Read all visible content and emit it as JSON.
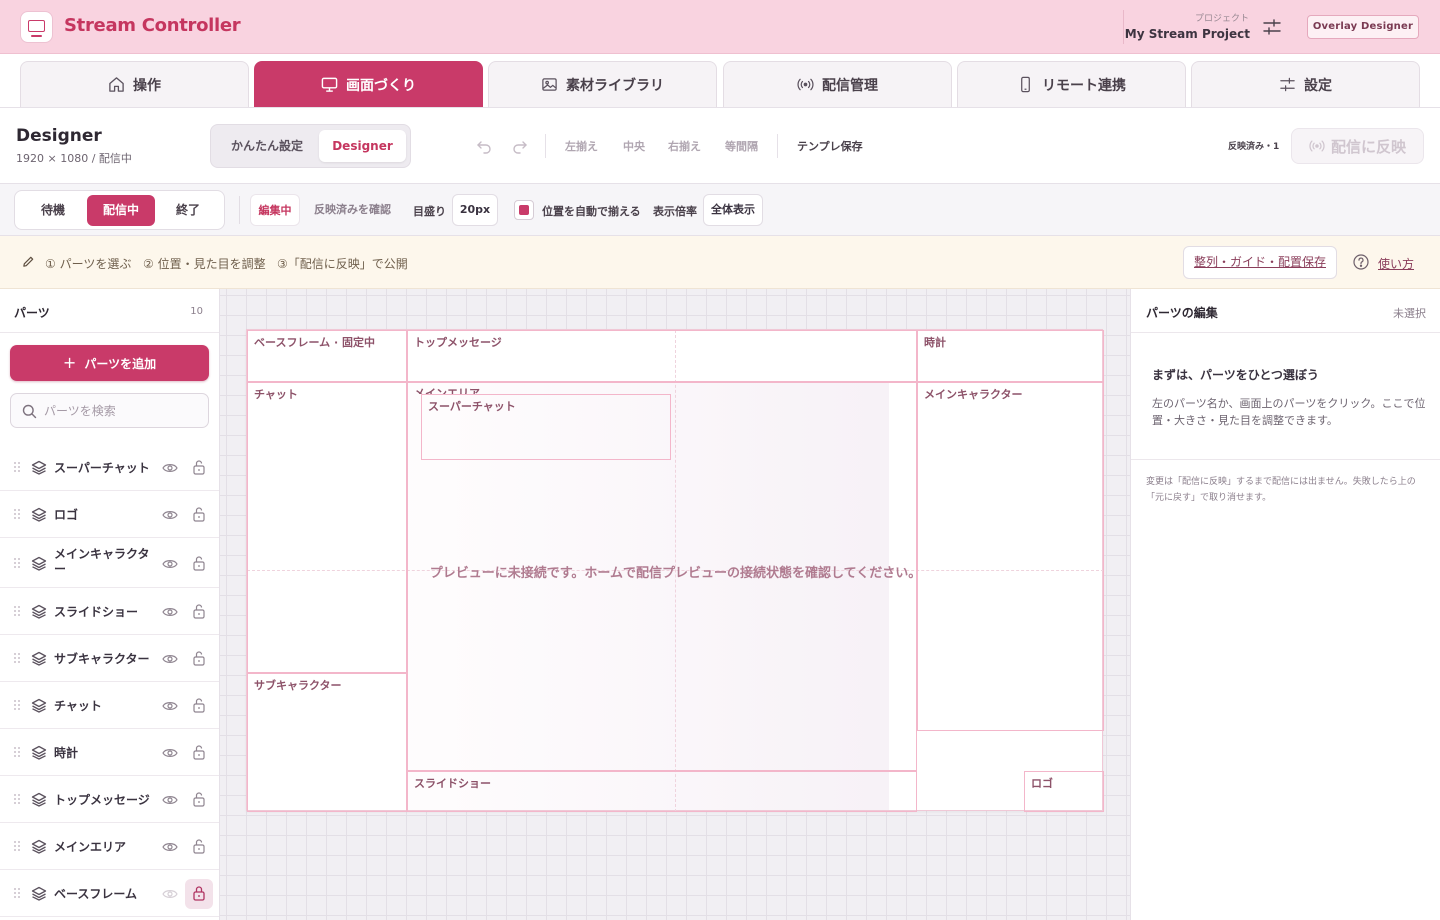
{
  "header": {
    "app_title": "Stream Controller",
    "project_caption": "プロジェクト",
    "project_name": "My Stream Project",
    "overlay_button": "Overlay Designer"
  },
  "tabs": [
    {
      "label": "操作",
      "icon": "home-icon"
    },
    {
      "label": "画面づくり",
      "icon": "monitor-icon",
      "active": true
    },
    {
      "label": "素材ライブラリ",
      "icon": "image-icon"
    },
    {
      "label": "配信管理",
      "icon": "broadcast-icon"
    },
    {
      "label": "リモート連携",
      "icon": "phone-icon"
    },
    {
      "label": "設定",
      "icon": "sliders-icon"
    }
  ],
  "toolbar": {
    "title": "Designer",
    "subtitle": "1920 × 1080 / 配信中",
    "mode_easy": "かんたん設定",
    "mode_designer": "Designer",
    "align_left": "左揃え",
    "align_center": "中央",
    "align_right": "右揃え",
    "distribute": "等間隔",
    "save_template": "テンプレ保存",
    "reflect_count": "反映済み・1",
    "reflect_button": "配信に反映"
  },
  "scene_bar": {
    "scenes": [
      "待機",
      "配信中",
      "終了"
    ],
    "active_scene": "配信中",
    "state_edit": "編集中",
    "state_check": "反映済みを確認",
    "grid_label": "目盛り",
    "grid_value": "20px",
    "snap_label": "位置を自動で揃える",
    "snap_checked": true,
    "zoom_label": "表示倍率",
    "zoom_value": "全体表示"
  },
  "hint_bar": {
    "step1": "① パーツを選ぶ",
    "step2": "② 位置・見た目を調整",
    "step3": "③「配信に反映」で公開",
    "guide_button": "整列・ガイド・配置保存",
    "help_link": "使い方"
  },
  "sidebar": {
    "title": "パーツ",
    "count": "10",
    "add_button": "パーツを追加",
    "search_placeholder": "パーツを検索",
    "parts": [
      {
        "name": "スーパーチャット",
        "locked": false
      },
      {
        "name": "ロゴ",
        "locked": false
      },
      {
        "name": "メインキャラクター",
        "locked": false
      },
      {
        "name": "スライドショー",
        "locked": false
      },
      {
        "name": "サブキャラクター",
        "locked": false
      },
      {
        "name": "チャット",
        "locked": false
      },
      {
        "name": "時計",
        "locked": false
      },
      {
        "name": "トップメッセージ",
        "locked": false
      },
      {
        "name": "メインエリア",
        "locked": false
      },
      {
        "name": "ベースフレーム",
        "locked": true
      }
    ]
  },
  "canvas": {
    "zones": {
      "base_frame": "ベースフレーム · 固定中",
      "top_message": "トップメッセージ",
      "clock": "時計",
      "chat": "チャット",
      "main_area": "メインエリア",
      "super_chat": "スーパーチャット",
      "main_character": "メインキャラクター",
      "sub_character": "サブキャラクター",
      "slideshow": "スライドショー",
      "logo": "ロゴ"
    },
    "message": "プレビューに未接続です。ホームで配信プレビューの接続状態を確認してください。"
  },
  "right_panel": {
    "title": "パーツの編集",
    "status": "未選択",
    "heading": "まずは、パーツをひとつ選ぼう",
    "body": "左のパーツ名か、画面上のパーツをクリック。ここで位置・大きさ・見た目を調整できます。",
    "note": "変更は「配信に反映」するまで配信には出ません。失敗したら上の「元に戻す」で取り消せます。"
  },
  "colors": {
    "accent": "#c93a69",
    "header_bg": "#f9d3e0",
    "hint_bg": "#fdf7ec"
  }
}
